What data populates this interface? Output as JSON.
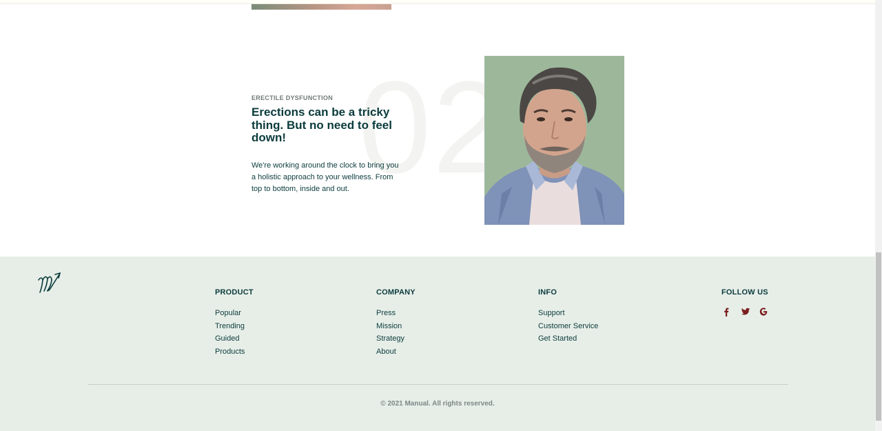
{
  "feature": {
    "number": "02",
    "eyebrow": "ERECTILE DYSFUNCTION",
    "headline": "Erections can be a tricky thing. But no need to feel down!",
    "body": "We're working around the clock to bring you a holistic approach to your wellness. From top to bottom, inside and out."
  },
  "footer": {
    "logo_icon": "manual-signature-logo",
    "columns": [
      {
        "title": "PRODUCT",
        "links": [
          "Popular",
          "Trending",
          "Guided",
          "Products"
        ]
      },
      {
        "title": "COMPANY",
        "links": [
          "Press",
          "Mission",
          "Strategy",
          "About"
        ]
      },
      {
        "title": "INFO",
        "links": [
          "Support",
          "Customer Service",
          "Get Started"
        ]
      }
    ],
    "follow": {
      "title": "FOLLOW US",
      "icons": [
        "facebook-icon",
        "twitter-icon",
        "google-icon"
      ]
    },
    "copyright": "© 2021 Manual. All rights reserved."
  },
  "colors": {
    "primary": "#0b3b3c",
    "footer_bg": "#e7eee8",
    "social": "#7b1e1e"
  }
}
